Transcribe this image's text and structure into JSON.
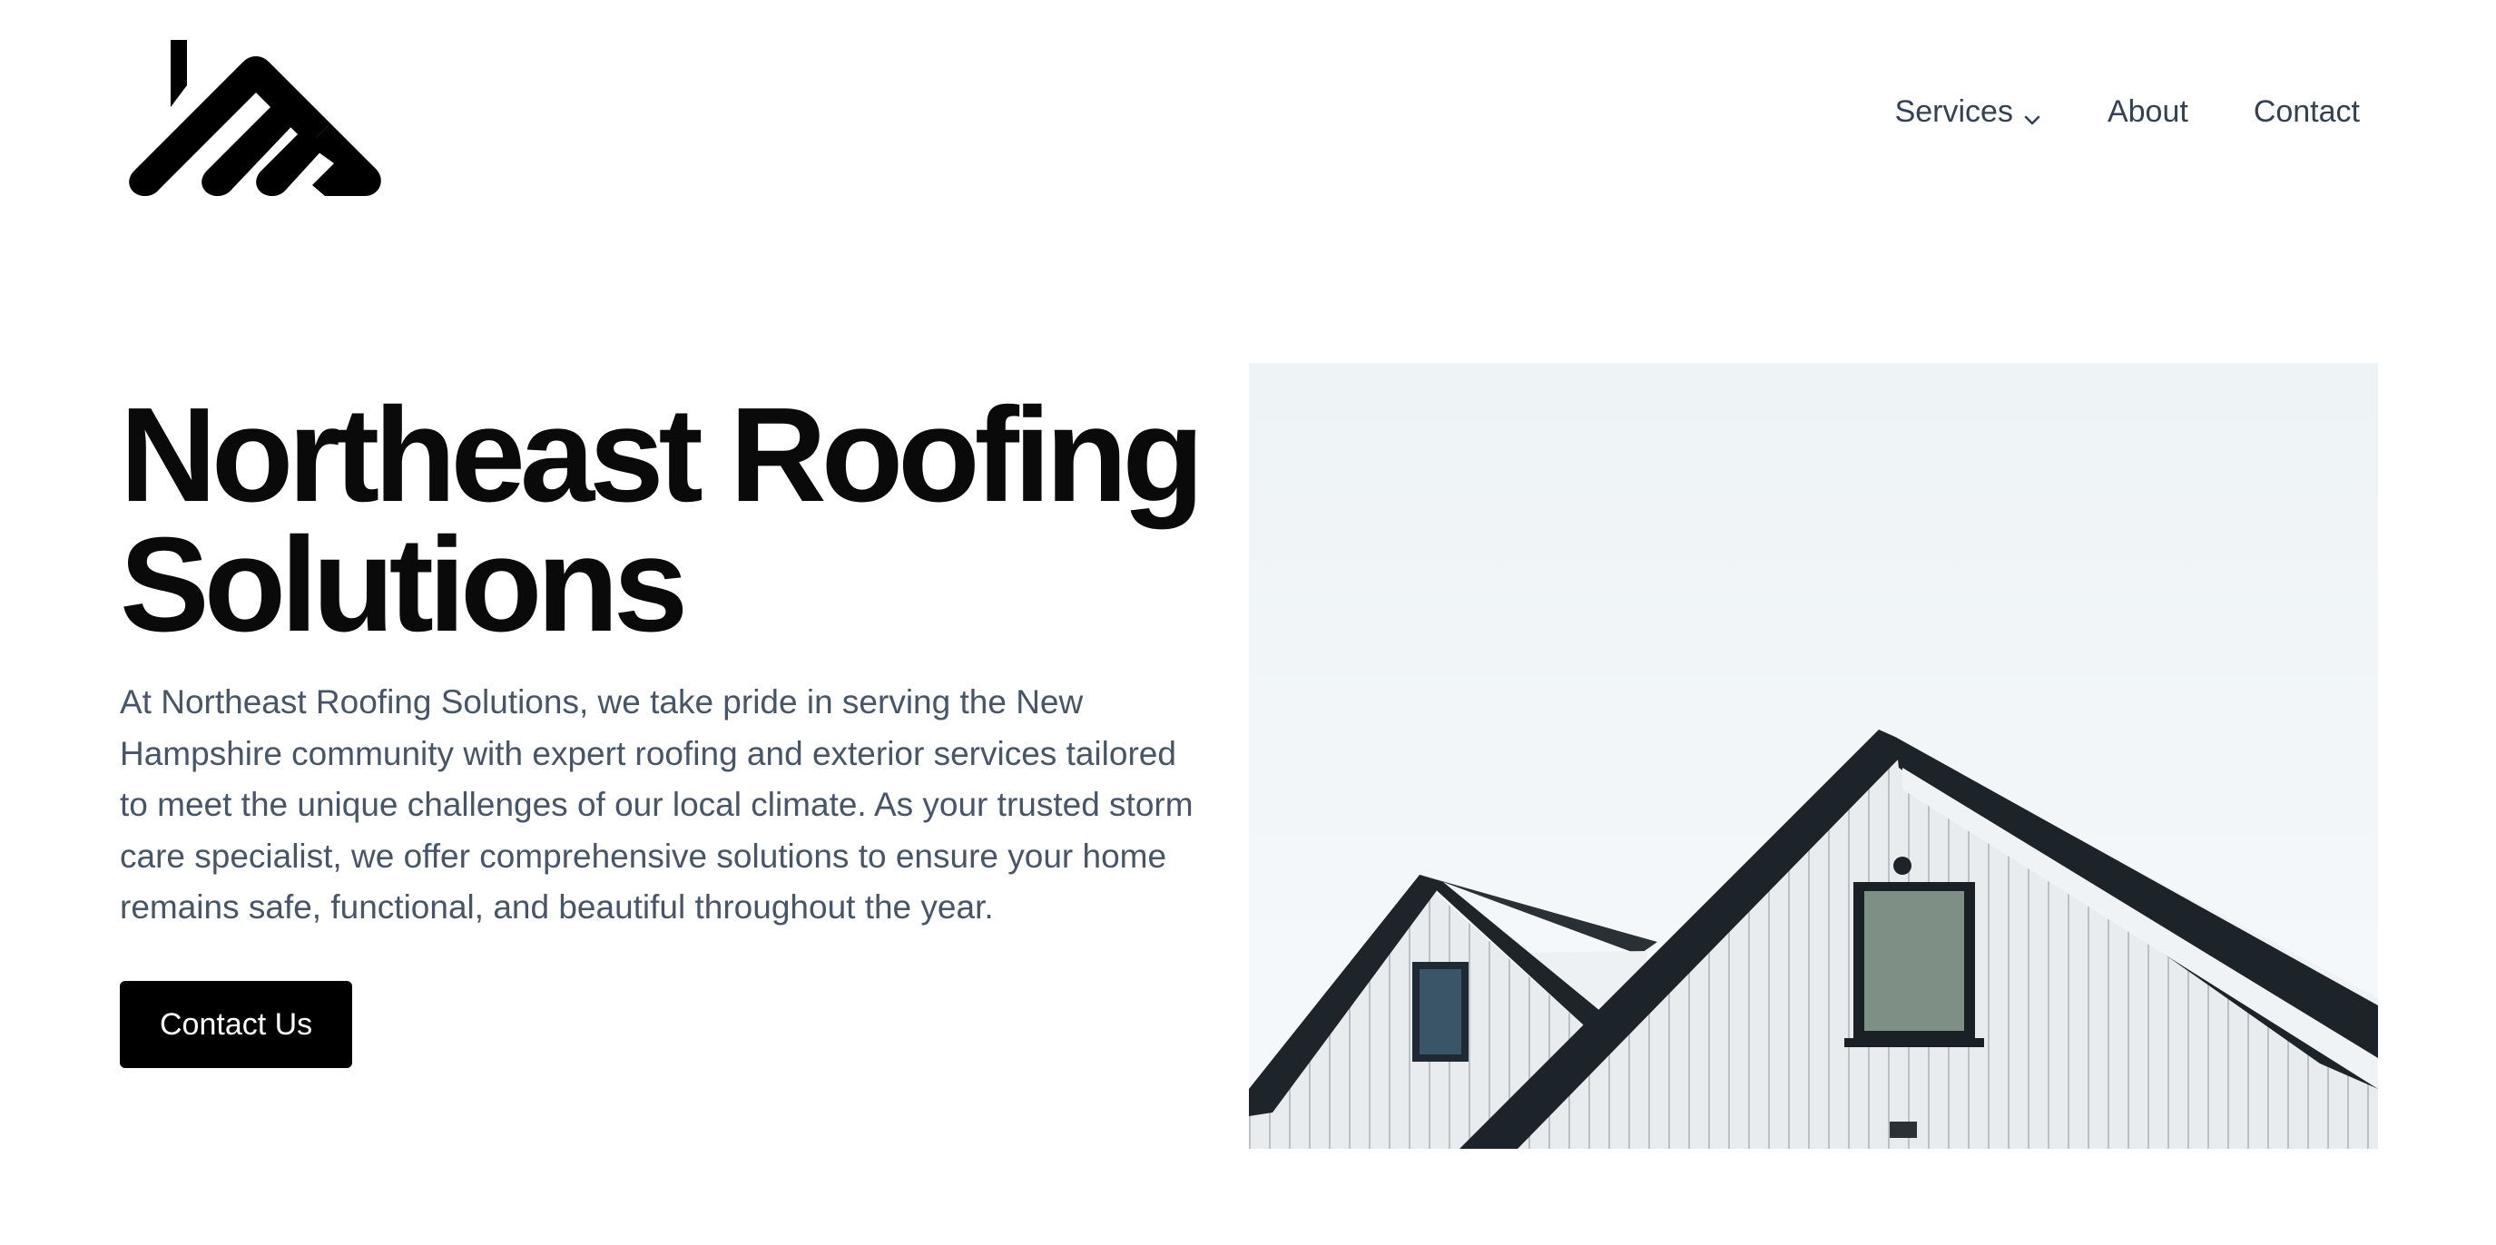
{
  "brand": {
    "logo_icon": "roof-logo-icon"
  },
  "nav": {
    "items": [
      {
        "label": "Services",
        "has_dropdown": true,
        "icon": "chevron-down-icon"
      },
      {
        "label": "About",
        "has_dropdown": false
      },
      {
        "label": "Contact",
        "has_dropdown": false
      }
    ]
  },
  "hero": {
    "title_line1": "Northeast Roofing",
    "title_line2": "Solutions",
    "description": "At Northeast Roofing Solutions, we take pride in serving the New Hampshire community with expert roofing and exterior services tailored to meet the unique challenges of our local climate. As your trusted storm care specialist, we offer comprehensive solutions to ensure your home remains safe, functional, and beautiful throughout the year.",
    "cta_label": "Contact Us",
    "image_subject": "snow-covered white house roofs against winter sky"
  },
  "colors": {
    "text_primary": "#0a0a0a",
    "text_muted": "#475569",
    "nav_text": "#334155",
    "button_bg": "#000000",
    "button_text": "#ffffff"
  }
}
